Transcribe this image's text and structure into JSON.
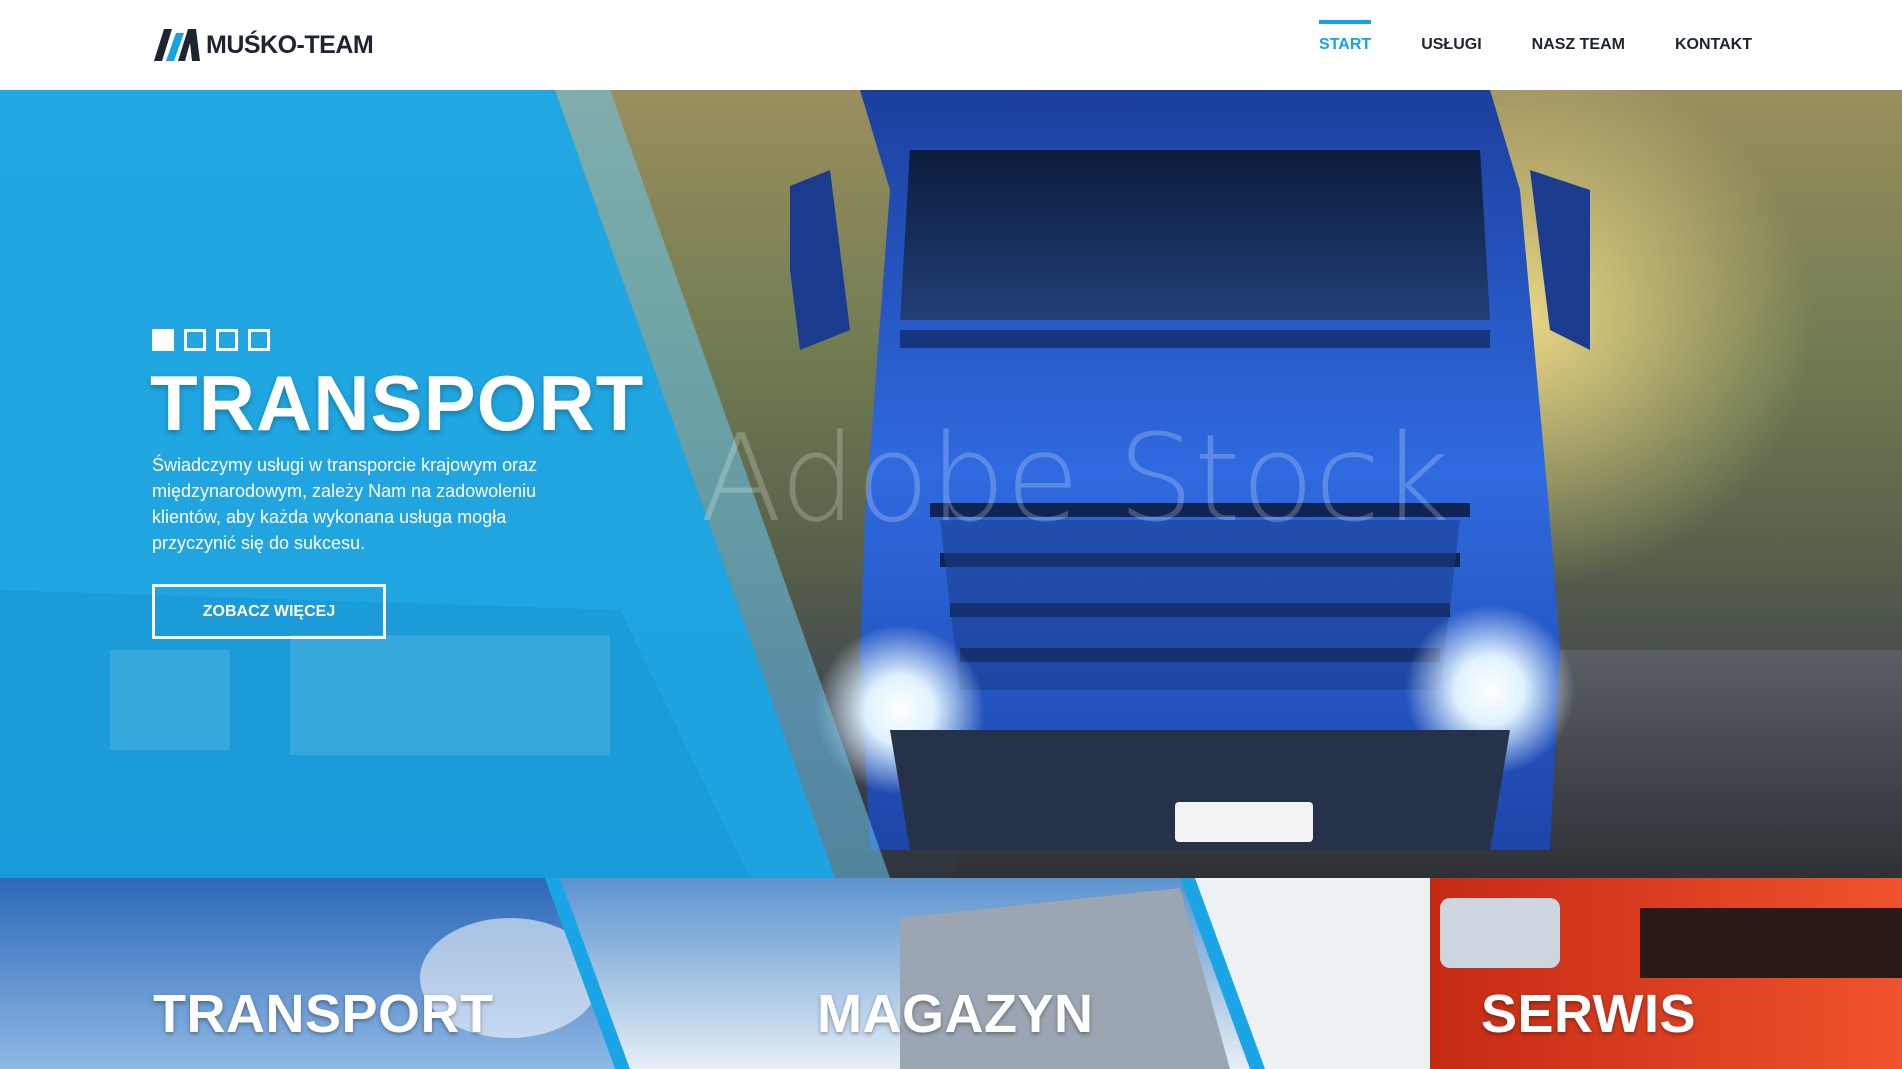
{
  "header": {
    "logo_text": "MUŚKO-TEAM",
    "nav": [
      {
        "label": "START",
        "active": true
      },
      {
        "label": "USŁUGI",
        "active": false
      },
      {
        "label": "NASZ TEAM",
        "active": false
      },
      {
        "label": "KONTAKT",
        "active": false
      }
    ]
  },
  "hero": {
    "slide_count": 4,
    "active_slide": 1,
    "title": "TRANSPORT",
    "description": "Świadczymy usługi w transporcie krajowym oraz międzynarodowym, zależy Nam na zadowoleniu klientów, aby każda wykonana usługa mogła przyczynić się do sukcesu.",
    "button_label": "ZOBACZ WIĘCEJ",
    "watermark": "Adobe Stock"
  },
  "tiles": [
    {
      "title": "TRANSPORT"
    },
    {
      "title": "MAGAZYN"
    },
    {
      "title": "SERWIS"
    }
  ],
  "colors": {
    "accent": "#16a3e4",
    "text_dark": "#1e2431",
    "truck_blue": "#2a63d6",
    "serwis_red": "#e23b1f"
  }
}
